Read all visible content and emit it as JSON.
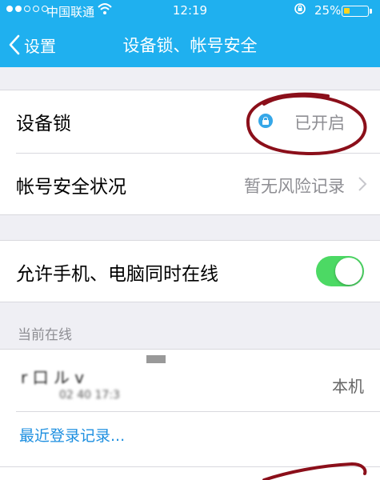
{
  "status_bar": {
    "carrier": "中国联通",
    "time": "12:19",
    "battery_percent": "25%",
    "signal_bars_filled": 2,
    "battery_level": 0.25
  },
  "nav": {
    "back_label": "设置",
    "title": "设备锁、帐号安全"
  },
  "security": {
    "device_lock": {
      "label": "设备锁",
      "value": "已开启"
    },
    "account_status": {
      "label": "帐号安全状况",
      "value": "暂无风险记录"
    }
  },
  "online": {
    "allow_label": "允许手机、电脑同时在线",
    "toggle_on": true,
    "section_header": "当前在线",
    "device": {
      "name": "r    口 ル v",
      "time": "02 40 17:3",
      "tag": "本机"
    },
    "recent_link": "最近登录记录..."
  },
  "colors": {
    "nav_bar": "#1fb0ef",
    "toggle_on": "#4cd964",
    "link": "#1d8fe0",
    "annotation": "#8b0f1a"
  }
}
